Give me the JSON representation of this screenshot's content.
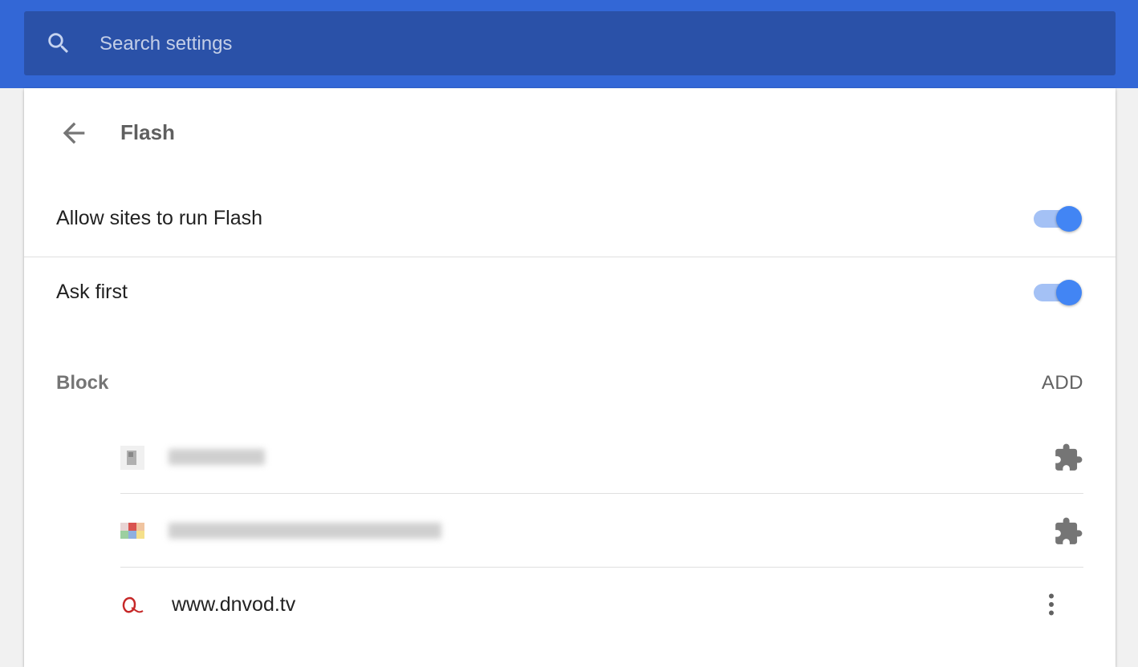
{
  "search": {
    "placeholder": "Search settings",
    "value": ""
  },
  "page": {
    "title": "Flash"
  },
  "settings": [
    {
      "label": "Allow sites to run Flash",
      "enabled": true
    },
    {
      "label": "Ask first",
      "enabled": true
    }
  ],
  "block_section": {
    "header": "Block",
    "add_label": "ADD",
    "sites": [
      {
        "name": "",
        "icon": "puzzle-icon",
        "blurred": true
      },
      {
        "name": "",
        "icon": "puzzle-icon",
        "blurred": true
      },
      {
        "name": "www.dnvod.tv",
        "icon": "more-vert-icon",
        "blurred": false
      }
    ]
  },
  "colors": {
    "header_bg": "#3367d6",
    "search_bg": "#2a51a8",
    "toggle_knob": "#4285f4",
    "toggle_track": "#a4c1f5"
  }
}
